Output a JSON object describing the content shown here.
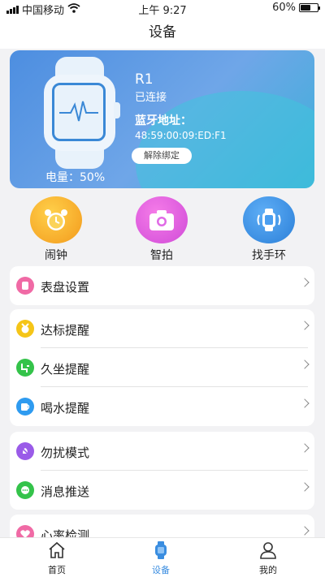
{
  "status_bar": {
    "carrier": "中国移动",
    "time": "上午 9:27",
    "battery": "60%",
    "battery_level": 0.6
  },
  "nav": {
    "title": "设备"
  },
  "device": {
    "name": "R1",
    "status": "已连接",
    "bt_label": "蓝牙地址：",
    "bt_address": "48:59:00:09:ED:F1",
    "unbind_label": "解除绑定",
    "battery_text": "电量：50%"
  },
  "quick_actions": [
    {
      "label": "闹钟",
      "icon": "alarm-clock-icon",
      "color": "#f5a623"
    },
    {
      "label": "智拍",
      "icon": "camera-icon",
      "color": "#d94be0"
    },
    {
      "label": "找手环",
      "icon": "find-band-icon",
      "color": "#2f88dd"
    }
  ],
  "settings": {
    "group1": [
      {
        "label": "表盘设置",
        "icon": "watch-face-icon",
        "color": "#f06aa5"
      }
    ],
    "group2": [
      {
        "label": "达标提醒",
        "icon": "medal-icon",
        "color": "#f5c518"
      },
      {
        "label": "久坐提醒",
        "icon": "sedentary-icon",
        "color": "#34c34a"
      },
      {
        "label": "喝水提醒",
        "icon": "cup-icon",
        "color": "#2e9bf0"
      }
    ],
    "group3": [
      {
        "label": "勿扰模式",
        "icon": "do-not-disturb-icon",
        "color": "#9a5be8"
      },
      {
        "label": "消息推送",
        "icon": "message-icon",
        "color": "#34c34a"
      }
    ],
    "group4": [
      {
        "label": "心率检测",
        "icon": "heart-rate-icon",
        "color": "#f06aa5"
      }
    ]
  },
  "tabbar": [
    {
      "label": "首页",
      "icon": "home-icon"
    },
    {
      "label": "设备",
      "icon": "device-watch-icon",
      "active": true
    },
    {
      "label": "我的",
      "icon": "profile-icon"
    }
  ]
}
